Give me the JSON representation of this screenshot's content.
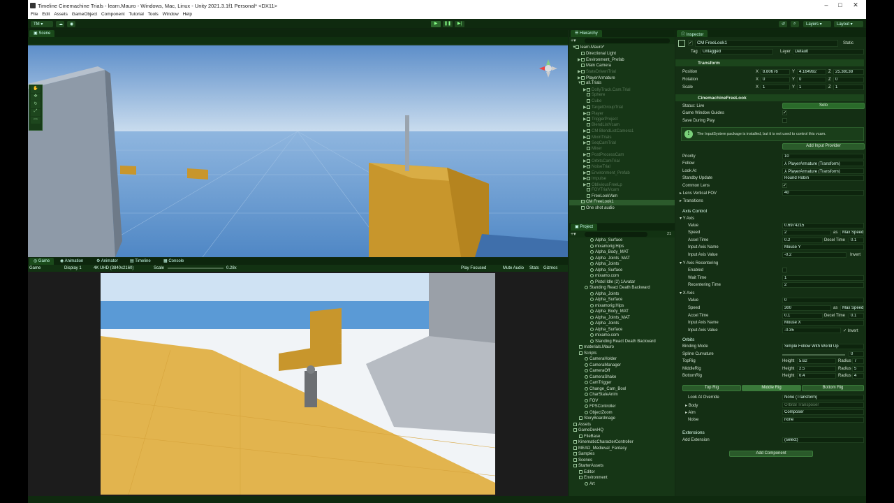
{
  "window": {
    "title": "Timeline Cinemachine Trials - learn.Mauro - Windows, Mac, Linux - Unity 2021.3.1f1 Personal* <DX11>"
  },
  "menu": [
    "File",
    "Edit",
    "Assets",
    "GameObject",
    "Component",
    "Tutorial",
    "Tools",
    "Window",
    "Help"
  ],
  "toolbar": {
    "account": "TM",
    "layers": "Layers",
    "layout": "Layout"
  },
  "scene": {
    "tab": "Scene"
  },
  "game": {
    "tabs": [
      "Game",
      "Animation",
      "Animator",
      "Timeline",
      "Console"
    ],
    "display_mode": "Game",
    "display": "Display 1",
    "resolution": "4K UHD (3840x2160)",
    "scale_label": "Scale",
    "scale_value": "0.28x",
    "play_focused": "Play Focused",
    "mute": "Mute Audio",
    "stats": "Stats",
    "gizmos": "Gizmos"
  },
  "hierarchy": {
    "tab": "Hierarchy",
    "search_placeholder": "All",
    "items": [
      {
        "label": "learn.Mauro*",
        "indent": 0,
        "dim": false,
        "sel": false,
        "exp": "▼"
      },
      {
        "label": "Directional Light",
        "indent": 1,
        "dim": false,
        "sel": false,
        "exp": ""
      },
      {
        "label": "Environment_Prefab",
        "indent": 1,
        "dim": false,
        "sel": false,
        "exp": "▶"
      },
      {
        "label": "Main Camera",
        "indent": 1,
        "dim": false,
        "sel": false,
        "exp": ""
      },
      {
        "label": "StateDrivenTrial",
        "indent": 1,
        "dim": true,
        "sel": false,
        "exp": "▶"
      },
      {
        "label": "PlayerArmature",
        "indent": 1,
        "dim": false,
        "sel": false,
        "exp": "▶"
      },
      {
        "label": "all.Trials",
        "indent": 1,
        "dim": false,
        "sel": false,
        "exp": "▼"
      },
      {
        "label": "DollyTrack.Cam.Trial",
        "indent": 2,
        "dim": true,
        "sel": false,
        "exp": "▶"
      },
      {
        "label": "Sphere",
        "indent": 2,
        "dim": true,
        "sel": false,
        "exp": ""
      },
      {
        "label": "Cube",
        "indent": 2,
        "dim": true,
        "sel": false,
        "exp": ""
      },
      {
        "label": "TargetGroupTrial",
        "indent": 2,
        "dim": true,
        "sel": false,
        "exp": "▶"
      },
      {
        "label": "Player",
        "indent": 2,
        "dim": true,
        "sel": false,
        "exp": "▶"
      },
      {
        "label": "TriggerProject",
        "indent": 2,
        "dim": true,
        "sel": false,
        "exp": "▶"
      },
      {
        "label": "BlendListVcam",
        "indent": 2,
        "dim": true,
        "sel": false,
        "exp": ""
      },
      {
        "label": "CM BlendListCamera1",
        "indent": 2,
        "dim": true,
        "sel": false,
        "exp": "▶"
      },
      {
        "label": "MixinTrials",
        "indent": 2,
        "dim": true,
        "sel": false,
        "exp": "▶"
      },
      {
        "label": "SeqCamTrial",
        "indent": 2,
        "dim": true,
        "sel": false,
        "exp": "▶"
      },
      {
        "label": "Mixer",
        "indent": 2,
        "dim": true,
        "sel": false,
        "exp": ""
      },
      {
        "label": "PostProcessCam",
        "indent": 2,
        "dim": true,
        "sel": false,
        "exp": "▶"
      },
      {
        "label": "OrbitsCamTrial",
        "indent": 2,
        "dim": true,
        "sel": false,
        "exp": "▶"
      },
      {
        "label": "NoiseTrial",
        "indent": 2,
        "dim": true,
        "sel": false,
        "exp": "▶"
      },
      {
        "label": "Environment_Prefab",
        "indent": 2,
        "dim": true,
        "sel": false,
        "exp": "▶"
      },
      {
        "label": "Impulse",
        "indent": 2,
        "dim": true,
        "sel": false,
        "exp": "▶"
      },
      {
        "label": "ObliviousFreeLp",
        "indent": 2,
        "dim": true,
        "sel": false,
        "exp": "▶"
      },
      {
        "label": "FOVTrialVcam",
        "indent": 2,
        "dim": true,
        "sel": false,
        "exp": ""
      },
      {
        "label": "FreeLookVam",
        "indent": 2,
        "dim": false,
        "sel": false,
        "exp": ""
      },
      {
        "label": "CM FreeLook1",
        "indent": 1,
        "dim": false,
        "sel": true,
        "exp": ""
      },
      {
        "label": "One shot audio",
        "indent": 1,
        "dim": false,
        "sel": false,
        "exp": ""
      }
    ]
  },
  "project": {
    "tab": "Project",
    "count": "21",
    "items": [
      {
        "label": "Alpha_Surface",
        "indent": 3
      },
      {
        "label": "mixamorig:Hips",
        "indent": 3
      },
      {
        "label": "Alpha_Body_MAT",
        "indent": 3
      },
      {
        "label": "Alpha_Joints_MAT",
        "indent": 3
      },
      {
        "label": "Alpha_Joints",
        "indent": 3
      },
      {
        "label": "Alpha_Surface",
        "indent": 3
      },
      {
        "label": "mixamo.com",
        "indent": 3
      },
      {
        "label": "Pistol Idle (2) 1Avatar",
        "indent": 3
      },
      {
        "label": "Standing React Death Backward",
        "indent": 2
      },
      {
        "label": "Alpha_Joints",
        "indent": 3
      },
      {
        "label": "Alpha_Surface",
        "indent": 3
      },
      {
        "label": "mixamorig:Hips",
        "indent": 3
      },
      {
        "label": "Alpha_Body_MAT",
        "indent": 3
      },
      {
        "label": "Alpha_Joints_MAT",
        "indent": 3
      },
      {
        "label": "Alpha_Joints",
        "indent": 3
      },
      {
        "label": "Alpha_Surface",
        "indent": 3
      },
      {
        "label": "mixamo.com",
        "indent": 3
      },
      {
        "label": "Standing React Death Backward",
        "indent": 3
      },
      {
        "label": "materials.Mauro",
        "indent": 1
      },
      {
        "label": "Scripts",
        "indent": 1
      },
      {
        "label": "CameraHolder",
        "indent": 2
      },
      {
        "label": "CameraManager",
        "indent": 2
      },
      {
        "label": "CameraOff",
        "indent": 2
      },
      {
        "label": "CameraShake",
        "indent": 2
      },
      {
        "label": "CamTrigger",
        "indent": 2
      },
      {
        "label": "Change_Cam_Bool",
        "indent": 2
      },
      {
        "label": "CharStateAnim",
        "indent": 2
      },
      {
        "label": "FOV",
        "indent": 2
      },
      {
        "label": "FPSController",
        "indent": 2
      },
      {
        "label": "ObjectZoom",
        "indent": 2
      },
      {
        "label": "StoryBoardmage",
        "indent": 1
      },
      {
        "label": "Assets",
        "indent": 0
      },
      {
        "label": "GameDevHQ",
        "indent": 0
      },
      {
        "label": "FileBase",
        "indent": 1
      },
      {
        "label": "KinematicCharacterController",
        "indent": 0
      },
      {
        "label": "MEAD_Medieval_Fantasy",
        "indent": 0
      },
      {
        "label": "Samples",
        "indent": 0
      },
      {
        "label": "Scenes",
        "indent": 0
      },
      {
        "label": "StarterAssets",
        "indent": 0
      },
      {
        "label": "Editor",
        "indent": 1
      },
      {
        "label": "Environment",
        "indent": 1
      },
      {
        "label": "Art",
        "indent": 2
      }
    ]
  },
  "inspector": {
    "tab": "Inspector",
    "name": "CM FreeLook1",
    "static": "Static",
    "tag_label": "Tag",
    "tag": "Untagged",
    "layer_label": "Layer",
    "layer": "Default",
    "transform": {
      "title": "Transform",
      "position": "Position",
      "rotation": "Rotation",
      "scale": "Scale",
      "px": "8.80676",
      "py": "4.164992",
      "pz": "25.38138",
      "rx": "0",
      "ry": "0",
      "rz": "0",
      "sx": "1",
      "sy": "1",
      "sz": "1"
    },
    "freelook": {
      "title": "CinemachineFreeLook",
      "status_label": "Status: Live",
      "solo": "Solo",
      "live_update": "Late Update",
      "guides": "Game Window Guides",
      "save_play": "Save During Play",
      "info": "The InputSystem package is installed, but it is not used to control this vcam.",
      "add_input": "Add Input Provider",
      "priority_label": "Priority",
      "priority": "10",
      "follow_label": "Follow",
      "follow": "PlayerArmature (Transform)",
      "lookat_label": "Look At",
      "lookat": "PlayerArmature (Transform)",
      "standby_label": "Standby Update",
      "standby": "Round Robin",
      "common_lens": "Common Lens",
      "fov_label": "Lens Vertical FOV",
      "fov": "40",
      "transitions": "Transitions",
      "axis_control": "Axis Control",
      "yaxis": "Y Axis",
      "value_label": "Value",
      "y_value": "0.6974215",
      "speed_label": "Speed",
      "y_speed": "2",
      "as_label": "as",
      "max_speed": "Max Speed",
      "accel_label": "Accel Time",
      "y_accel": "0.2",
      "decel_label": "Decel Time",
      "y_decel": "0.1",
      "input_name_label": "Input Axis Name",
      "y_input": "Mouse Y",
      "input_value_label": "Input Axis Value",
      "y_input_value": "-0.2",
      "invert": "Invert",
      "y_recentering": "Y Axis Recentering",
      "enabled": "Enabled",
      "wait": "Wait Time",
      "wait_value": "1",
      "recenter_time": "Recentering Time",
      "recenter_value": "2",
      "xaxis": "X Axis",
      "x_value": "0",
      "x_speed": "300",
      "x_accel": "0.1",
      "x_decel": "0.1",
      "x_input": "Mouse X",
      "x_input_value": "-0.35",
      "orbits": "Orbits",
      "binding_label": "Binding Mode",
      "binding": "Simple Follow With World Up",
      "spline_label": "Spline Curvature",
      "spline": "0",
      "top_rig": "TopRig",
      "mid_rig": "MiddleRig",
      "bot_rig": "BottomRig",
      "height": "Height",
      "radius": "Radius",
      "top_h": "5.62",
      "top_r": "7",
      "mid_h": "2.5",
      "mid_r": "5",
      "bot_h": "0.4",
      "bot_r": "4",
      "tabs": [
        "Top Rig",
        "Middle Rig",
        "Bottom Rig"
      ],
      "look_override_label": "Look At Override",
      "look_override": "None (Transform)",
      "body_label": "Body",
      "body": "Orbital Transposer",
      "aim_label": "Aim",
      "aim": "Composer",
      "noise_label": "Noise",
      "noise": "none",
      "extensions": "Extensions",
      "add_ext_label": "Add Extension",
      "add_ext": "(select)",
      "add_component": "Add Component"
    }
  }
}
